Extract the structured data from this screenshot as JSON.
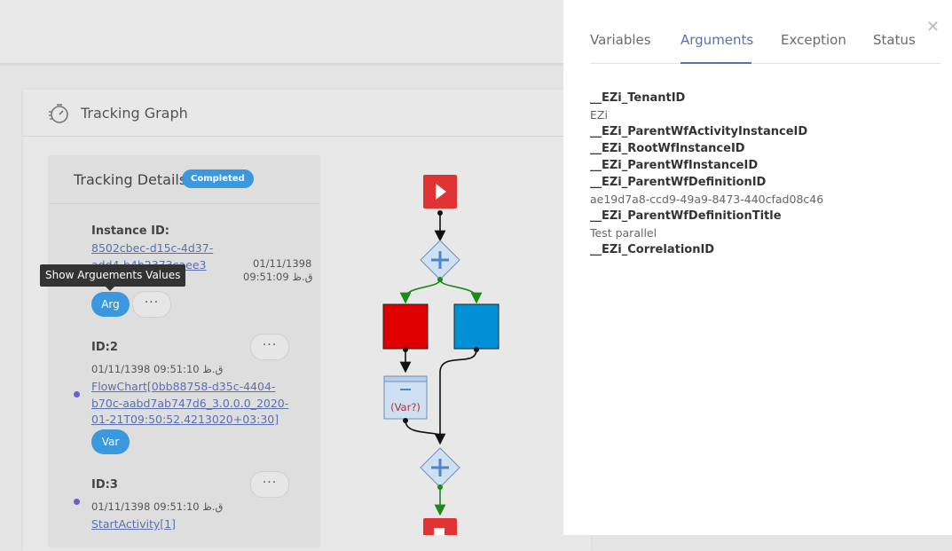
{
  "graph_panel": {
    "title": "Tracking Graph"
  },
  "details": {
    "title": "Tracking Details",
    "status_badge": "Completed",
    "instance_label": "Instance ID:",
    "instance_id_line1": "8502cbec-d15c-4d37-",
    "instance_id_line2": "add4-b4b2373caee3",
    "instance_date": "01/11/1398",
    "instance_time": "09:51:09 ق.ظ",
    "arg_button": "Arg",
    "dots": "···",
    "item2": {
      "id": "ID:2",
      "datetime": "01/11/1398 09:51:10 ق.ظ",
      "link_lines": [
        "FlowChart[0bb88758-d35c-4404-",
        "b70c-aabd7ab747d6_3.0.0.0_2020-",
        "01-21T09:50:52.4213020+03:30]"
      ],
      "var_button": "Var"
    },
    "item3": {
      "id": "ID:3",
      "datetime": "01/11/1398 09:51:10 ق.ظ",
      "link": "StartActivity[1]"
    }
  },
  "tooltip": "Show Arguements Values",
  "flow": {
    "var_node_label": "(Var?)"
  },
  "drawer": {
    "tabs": [
      "Variables",
      "Arguments",
      "Exception",
      "Status"
    ],
    "active_tab": "Arguments",
    "close_icon": "close-icon",
    "arguments": [
      {
        "type": "key",
        "text": "__EZi_TenantID"
      },
      {
        "type": "value",
        "text": "EZi"
      },
      {
        "type": "key",
        "text": "__EZi_ParentWfActivityInstanceID"
      },
      {
        "type": "key",
        "text": "__EZi_RootWfInstanceID"
      },
      {
        "type": "key",
        "text": "__EZi_ParentWfInstanceID"
      },
      {
        "type": "key",
        "text": "__EZi_ParentWfDefinitionID"
      },
      {
        "type": "value",
        "text": "ae19d7a8-ccd9-49a9-8473-440cfad08c46"
      },
      {
        "type": "key",
        "text": "__EZi_ParentWfDefinitionTitle"
      },
      {
        "type": "value",
        "text": "Test parallel"
      },
      {
        "type": "key",
        "text": "__EZi_CorrelationID"
      }
    ]
  },
  "colors": {
    "accent": "#3b97de",
    "tab_active": "#5b6fb0",
    "start_node": "#e03434",
    "red_node": "#e00000",
    "blue_node": "#0090d6"
  }
}
